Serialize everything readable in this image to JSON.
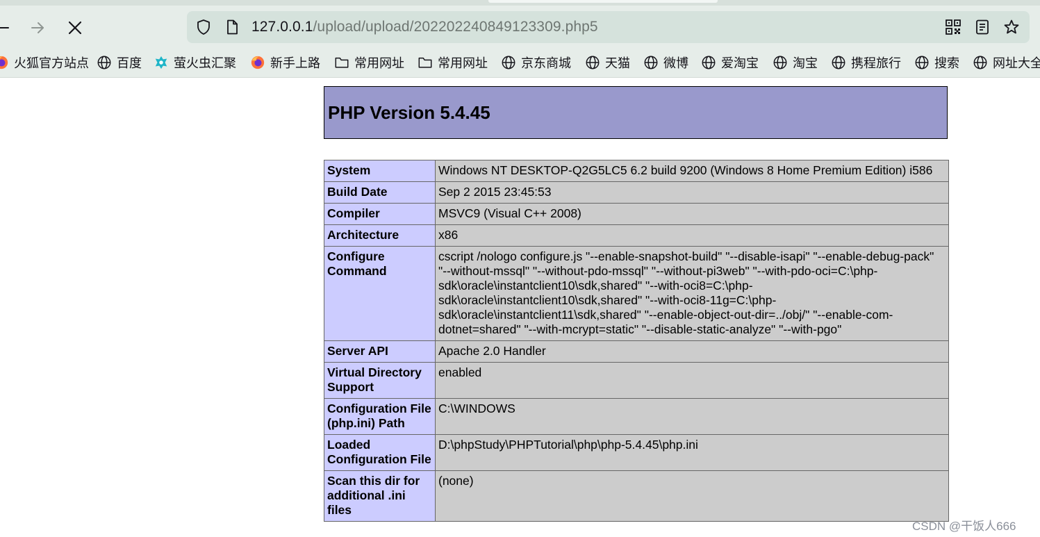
{
  "browser": {
    "url_host": "127.0.0.1",
    "url_path": "/upload/upload/202202240849123309.php5",
    "bookmarks": [
      {
        "label": "火狐官方站点",
        "icon": "firefox-icon"
      },
      {
        "label": "百度",
        "icon": "globe-icon"
      },
      {
        "label": "萤火虫汇聚",
        "icon": "firefly-icon"
      },
      {
        "label": "新手上路",
        "icon": "firefox-icon"
      },
      {
        "label": "常用网址",
        "icon": "folder-icon"
      },
      {
        "label": "常用网址",
        "icon": "folder-icon"
      },
      {
        "label": "京东商城",
        "icon": "globe-icon"
      },
      {
        "label": "天猫",
        "icon": "globe-icon"
      },
      {
        "label": "微博",
        "icon": "globe-icon"
      },
      {
        "label": "爱淘宝",
        "icon": "globe-icon"
      },
      {
        "label": "淘宝",
        "icon": "globe-icon"
      },
      {
        "label": "携程旅行",
        "icon": "globe-icon"
      },
      {
        "label": "搜索",
        "icon": "globe-icon"
      },
      {
        "label": "网址大全",
        "icon": "globe-icon"
      }
    ]
  },
  "phpinfo": {
    "title": "PHP Version 5.4.45",
    "rows": [
      {
        "key": "System",
        "value": "Windows NT DESKTOP-Q2G5LC5 6.2 build 9200 (Windows 8 Home Premium Edition) i586"
      },
      {
        "key": "Build Date",
        "value": "Sep 2 2015 23:45:53"
      },
      {
        "key": "Compiler",
        "value": "MSVC9 (Visual C++ 2008)"
      },
      {
        "key": "Architecture",
        "value": "x86"
      },
      {
        "key": "Configure Command",
        "value": "cscript /nologo configure.js \"--enable-snapshot-build\" \"--disable-isapi\" \"--enable-debug-pack\" \"--without-mssql\" \"--without-pdo-mssql\" \"--without-pi3web\" \"--with-pdo-oci=C:\\php-sdk\\oracle\\instantclient10\\sdk,shared\" \"--with-oci8=C:\\php-sdk\\oracle\\instantclient10\\sdk,shared\" \"--with-oci8-11g=C:\\php-sdk\\oracle\\instantclient11\\sdk,shared\" \"--enable-object-out-dir=../obj/\" \"--enable-com-dotnet=shared\" \"--with-mcrypt=static\" \"--disable-static-analyze\" \"--with-pgo\""
      },
      {
        "key": "Server API",
        "value": "Apache 2.0 Handler"
      },
      {
        "key": "Virtual Directory Support",
        "value": "enabled"
      },
      {
        "key": "Configuration File (php.ini) Path",
        "value": "C:\\WINDOWS"
      },
      {
        "key": "Loaded Configuration File",
        "value": "D:\\phpStudy\\PHPTutorial\\php\\php-5.4.45\\php.ini"
      },
      {
        "key": "Scan this dir for additional .ini files",
        "value": "(none)"
      }
    ]
  },
  "watermark": "CSDN @干饭人666",
  "colors": {
    "header_bg": "#9999cc",
    "key_bg": "#ccccff",
    "value_bg": "#cccccc",
    "chrome_bg": "#e6ede9",
    "urlbar_bg": "#d5e2dc"
  }
}
